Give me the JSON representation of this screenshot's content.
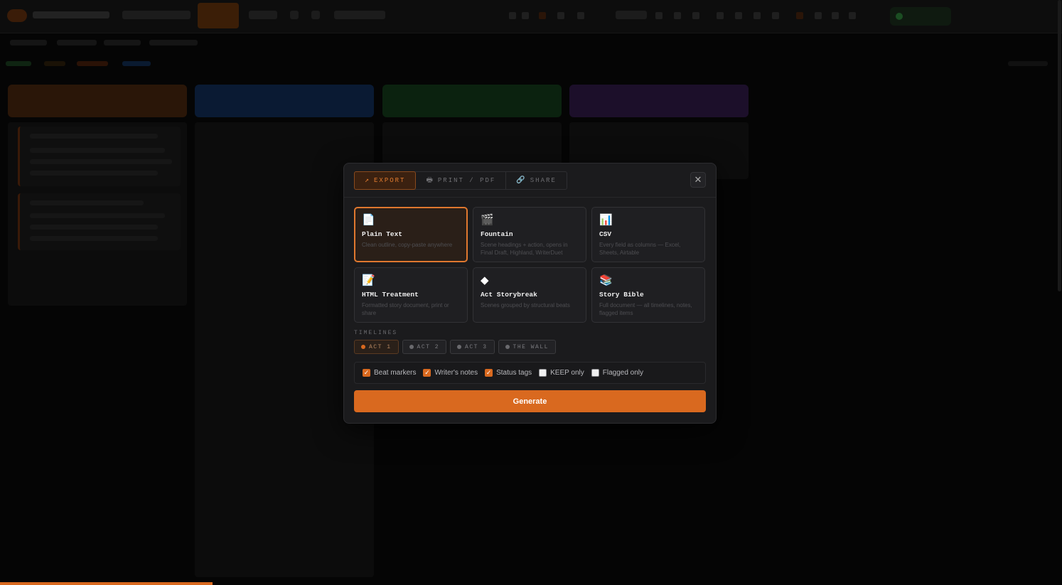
{
  "modal": {
    "tabs": [
      {
        "icon": "↗",
        "label": "EXPORT"
      },
      {
        "icon": "🖶",
        "label": "PRINT / PDF"
      },
      {
        "icon": "🔗",
        "label": "SHARE"
      }
    ],
    "close_icon": "✕",
    "formats": [
      {
        "icon": "📄",
        "name": "Plain Text",
        "desc": "Clean outline, copy-paste anywhere"
      },
      {
        "icon": "🎬",
        "name": "Fountain",
        "desc": "Scene headings + action, opens in Final Draft, Highland, WriterDuet"
      },
      {
        "icon": "📊",
        "name": "CSV",
        "desc": "Every field as columns — Excel, Sheets, Airtable"
      },
      {
        "icon": "📝",
        "name": "HTML Treatment",
        "desc": "Formatted story document, print or share"
      },
      {
        "icon": "◆",
        "name": "Act Storybreak",
        "desc": "Scenes grouped by structural beats"
      },
      {
        "icon": "📚",
        "name": "Story Bible",
        "desc": "Full document — all timelines, notes, flagged items"
      }
    ],
    "selected_format": "Plain Text",
    "timelines_label": "TIMELINES",
    "timelines": [
      {
        "label": "ACT 1",
        "selected": true
      },
      {
        "label": "ACT 2",
        "selected": false
      },
      {
        "label": "ACT 3",
        "selected": false
      },
      {
        "label": "THE WALL",
        "selected": false
      }
    ],
    "options": [
      {
        "label": "Beat markers",
        "checked": true
      },
      {
        "label": "Writer's notes",
        "checked": true
      },
      {
        "label": "Status tags",
        "checked": true
      },
      {
        "label": "KEEP only",
        "checked": false
      },
      {
        "label": "Flagged only",
        "checked": false
      }
    ],
    "generate_label": "Generate"
  },
  "colors": {
    "accent": "#d9691f",
    "col_orange": "#2a1608",
    "col_blue": "#0a1a33",
    "col_green": "#0b220f",
    "col_purple": "#1c0f2a"
  }
}
